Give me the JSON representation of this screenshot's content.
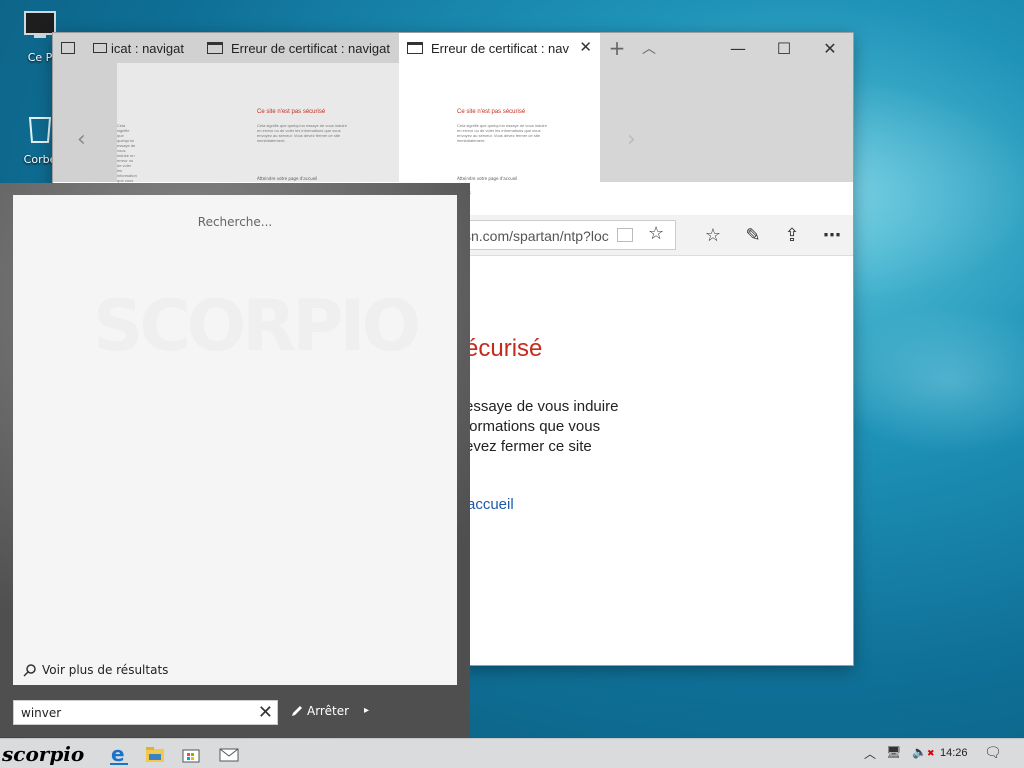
{
  "desktop": {
    "icons": [
      {
        "label": "Ce P",
        "icon": "computer-icon"
      },
      {
        "label": "Corbe",
        "icon": "recycle-bin-icon"
      }
    ]
  },
  "browser": {
    "tabs": [
      {
        "title": "icat : navigat",
        "icon": "tab-preview-icon",
        "active": false
      },
      {
        "title": "Erreur de certificat : navigat",
        "icon": "page-icon",
        "active": false
      },
      {
        "title": "Erreur de certificat : nav",
        "icon": "page-icon",
        "active": true
      }
    ],
    "thumbnail": {
      "title": "Ce site n'est pas sécurisé",
      "body": "Cela signifie que quelqu'un essaye de vous induire en erreur ou de voler les informations que vous envoyez au serveur. Vous devez fermer ce site immédiatement.",
      "link": "Atteindre votre page d'accueil",
      "details": "Détails"
    },
    "address": "msn.com/spartan/ntp?loc",
    "address_visible": "sn.com/spartan/ntp?loc",
    "page": {
      "title_visible": "écurisé",
      "line1": "essaye de vous induire",
      "line2": "formations que vous",
      "line3": "evez fermer ce site",
      "link_visible": "accueil"
    }
  },
  "search": {
    "status": "Recherche...",
    "more_results": "Voir plus de résultats",
    "query": "winver",
    "power_label": "Arrêter"
  },
  "taskbar": {
    "start_label": "scorpio",
    "apps": [
      "edge-icon",
      "file-explorer-icon",
      "store-icon",
      "mail-icon"
    ],
    "clock": "14:26"
  },
  "colors": {
    "accent_red": "#c42b1c",
    "link_blue": "#1e5aa8",
    "taskbar": "#d9dbdd"
  }
}
